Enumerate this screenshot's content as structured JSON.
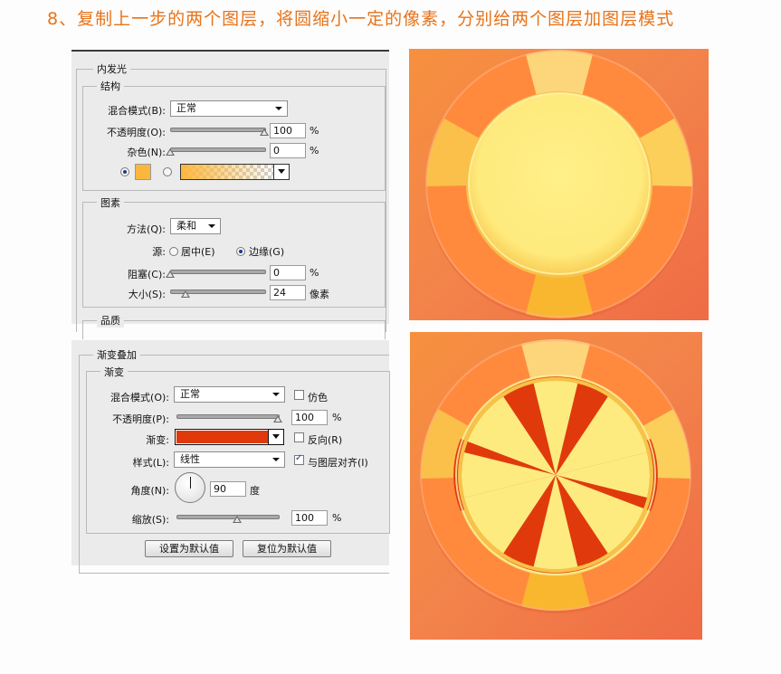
{
  "heading": "8、复制上一步的两个图层，将圆缩小一定的像素，分别给两个图层加图层模式",
  "inner_glow": {
    "panel_title": "内发光",
    "structure": {
      "title": "结构",
      "blend_mode_label": "混合模式(B):",
      "blend_mode_value": "正常",
      "opacity_label": "不透明度(O):",
      "opacity_value": "100",
      "opacity_unit": "%",
      "opacity_level": 1.0,
      "noise_label": "杂色(N):",
      "noise_value": "0",
      "noise_unit": "%",
      "noise_level": 0.0,
      "swatch_color": "#fbb73d"
    },
    "elements": {
      "title": "图素",
      "technique_label": "方法(Q):",
      "technique_value": "柔和",
      "source_label": "源:",
      "source_center": "居中(E)",
      "source_edge": "边缘(G)",
      "choke_label": "阻塞(C):",
      "choke_value": "0",
      "choke_unit": "%",
      "choke_level": 0.0,
      "size_label": "大小(S):",
      "size_value": "24",
      "size_unit": "像素",
      "size_level": 0.16
    },
    "quality_title": "品质"
  },
  "gradient_overlay": {
    "panel_title": "渐变叠加",
    "group_title": "渐变",
    "blend_mode_label": "混合模式(O):",
    "blend_mode_value": "正常",
    "dither_label": "仿色",
    "opacity_label": "不透明度(P):",
    "opacity_value": "100",
    "opacity_unit": "%",
    "opacity_level": 1.0,
    "gradient_label": "渐变:",
    "reverse_label": "反向(R)",
    "style_label": "样式(L):",
    "style_value": "线性",
    "align_label": "与图层对齐(I)",
    "angle_label": "角度(N):",
    "angle_value": "90",
    "angle_unit": "度",
    "scale_label": "缩放(S):",
    "scale_value": "100",
    "scale_unit": "%",
    "scale_level": 0.6,
    "make_default_label": "设置为默认值",
    "reset_default_label": "复位为默认值",
    "gradient_color": "#e03a0c"
  },
  "colors": {
    "heading": "#e7731a",
    "background_orange": "#f07a4a",
    "ring_orange": "#ff8a3d",
    "ring_yellow": "#fbc04a",
    "center_yellow": "#fdeb80",
    "wedge_red": "#e03a0c"
  }
}
